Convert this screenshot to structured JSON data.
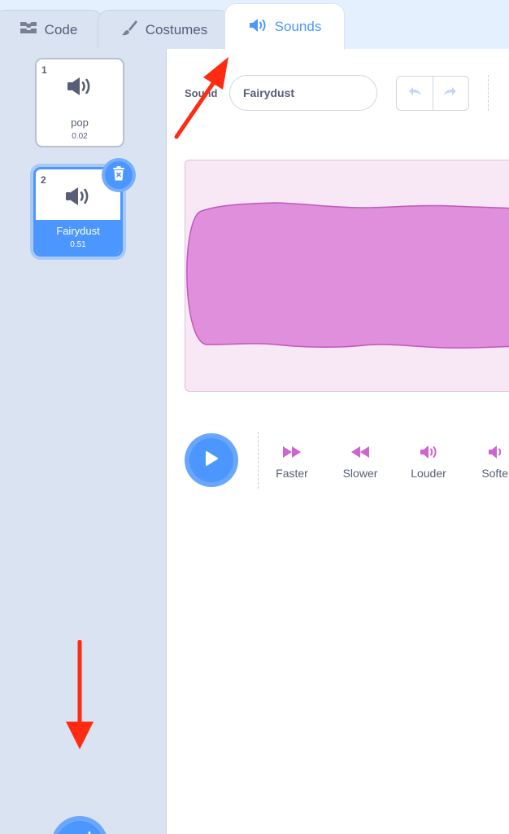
{
  "tabs": [
    {
      "label": "Code",
      "icon": "code-blocks-icon"
    },
    {
      "label": "Costumes",
      "icon": "paintbrush-icon"
    },
    {
      "label": "Sounds",
      "icon": "speaker-icon",
      "active": true
    }
  ],
  "sounds": [
    {
      "index": "1",
      "name": "pop",
      "duration": "0.02",
      "icon": "speaker-icon"
    },
    {
      "index": "2",
      "name": "Fairydust",
      "duration": "0.51",
      "icon": "speaker-icon",
      "selected": true
    }
  ],
  "editor": {
    "sound_label": "Sound",
    "sound_name": "Fairydust",
    "effects": [
      "Faster",
      "Slower",
      "Louder",
      "Softer"
    ]
  },
  "colors": {
    "accent": "#4c97ff",
    "sound_magenta": "#cf63cf",
    "waveform_fill": "#df8fdb",
    "sidebar_bg": "#d9e3f2",
    "tabbar_bg": "#e5f0ff",
    "annotation_arrow": "#ff2a12"
  },
  "annotations": [
    "arrow-to-sounds-tab",
    "arrow-to-add-sound-button"
  ]
}
